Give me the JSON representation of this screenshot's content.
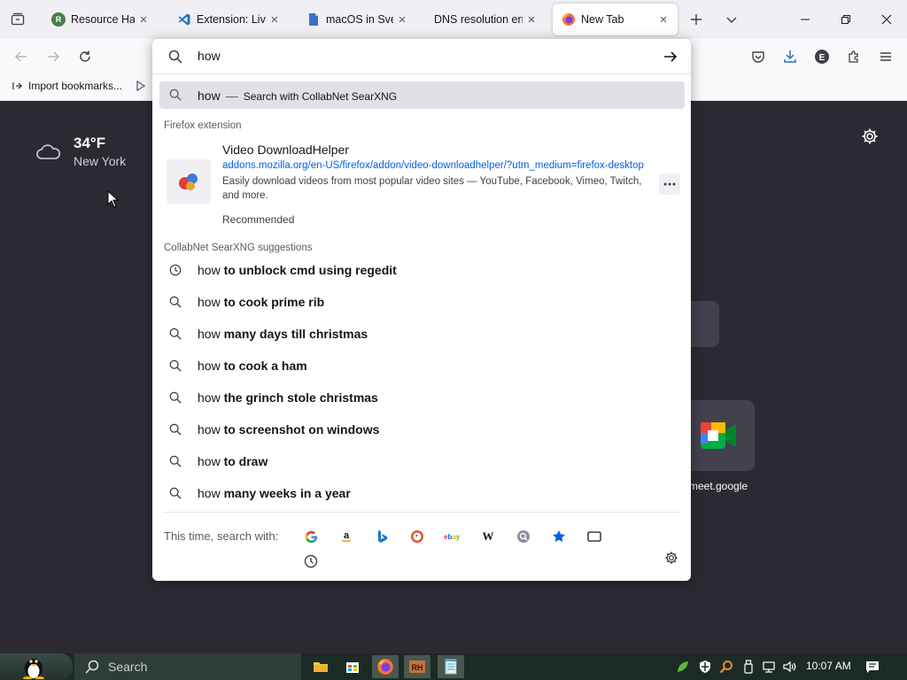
{
  "tabs": [
    {
      "title": "Resource Hacke",
      "favicon_color": "#4a7d4c"
    },
    {
      "title": "Extension: Live S",
      "favicon_color": "#1f76c9"
    },
    {
      "title": "macOS in Svelte",
      "favicon_color": "#3b72c8"
    },
    {
      "title": "DNS resolution error",
      "favicon_color": ""
    },
    {
      "title": "New Tab",
      "favicon_color": "#ff7139"
    }
  ],
  "urlbar": {
    "value": "how"
  },
  "first_result": {
    "query": "how",
    "separator": "—",
    "action": "Search with CollabNet SearXNG"
  },
  "extension_group": {
    "label": "Firefox extension",
    "title": "Video DownloadHelper",
    "url": "addons.mozilla.org/en-US/firefox/addon/video-downloadhelper/?utm_medium=firefox-desktop",
    "description": "Easily download videos from most popular video sites — YouTube, Facebook, Vimeo, Twitch, and more.",
    "tag": "Recommended"
  },
  "suggestions_group": {
    "label": "CollabNet SearXNG suggestions",
    "items": [
      {
        "prefix": "how",
        "rest": "to unblock cmd using regedit",
        "icon": "history-clock-icon"
      },
      {
        "prefix": "how",
        "rest": "to cook prime rib",
        "icon": "search-icon"
      },
      {
        "prefix": "how",
        "rest": "many days till christmas",
        "icon": "search-icon"
      },
      {
        "prefix": "how",
        "rest": "to cook a ham",
        "icon": "search-icon"
      },
      {
        "prefix": "how",
        "rest": "the grinch stole christmas",
        "icon": "search-icon"
      },
      {
        "prefix": "how",
        "rest": "to screenshot on windows",
        "icon": "search-icon"
      },
      {
        "prefix": "how",
        "rest": "to draw",
        "icon": "search-icon"
      },
      {
        "prefix": "how",
        "rest": "many weeks in a year",
        "icon": "search-icon"
      }
    ]
  },
  "footer": {
    "label": "This time, search with:",
    "engines": [
      "google-icon",
      "amazon-icon",
      "bing-icon",
      "duckduckgo-icon",
      "ebay-icon",
      "wikipedia-icon",
      "searxng-icon",
      "bookmarks-star-icon",
      "tabs-icon",
      "history-icon"
    ]
  },
  "bookmarks_bar": {
    "import_label": "Import bookmarks..."
  },
  "page": {
    "weather_temp": "34°F",
    "weather_city": "New York",
    "shortcut_label": "meet.google"
  },
  "taskbar": {
    "search_label": "Search",
    "clock": "10:07 AM"
  },
  "colors": {
    "accent": "#0060df",
    "page_bg": "#2b2a33",
    "highlight_row": "#e0e0e6"
  }
}
